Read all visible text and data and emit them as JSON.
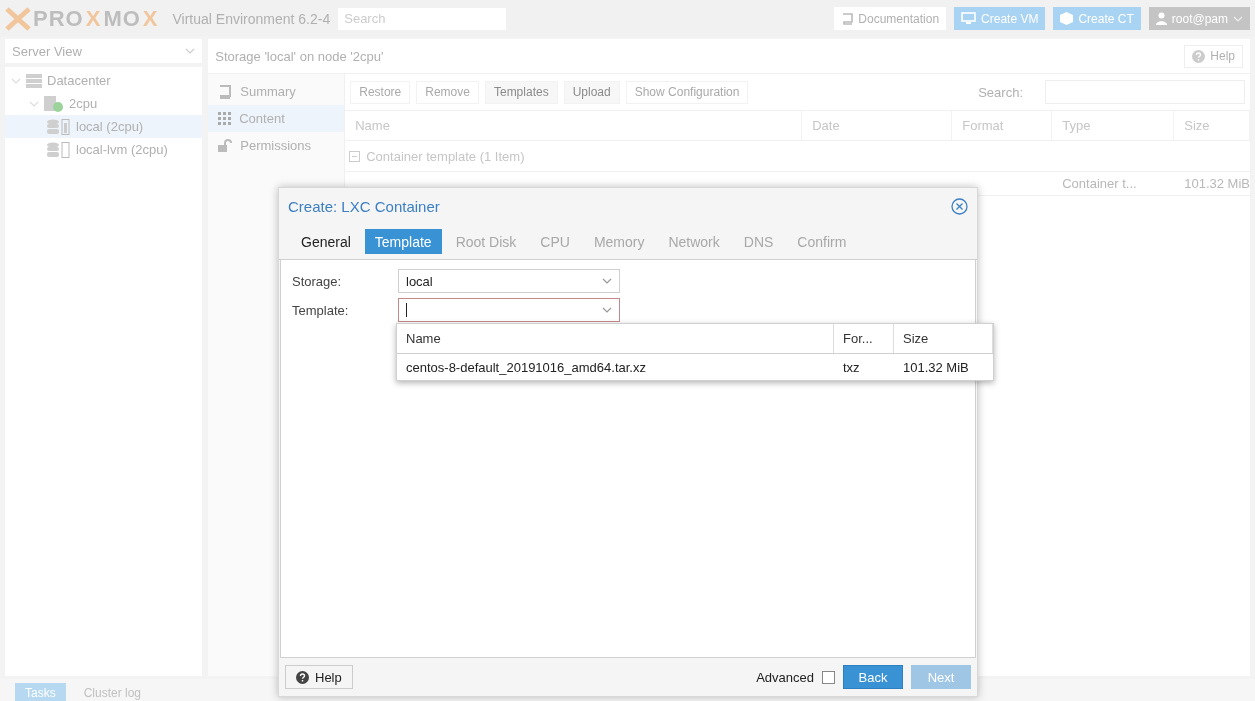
{
  "header": {
    "logo_parts": [
      {
        "text": "PRO",
        "accent": false
      },
      {
        "text": "X",
        "accent": true
      },
      {
        "text": "MO",
        "accent": false
      },
      {
        "text": "X",
        "accent": true
      }
    ],
    "product": "Virtual Environment 6.2-4",
    "search": {
      "placeholder": "Search"
    },
    "buttons": [
      {
        "kind": "doc",
        "label": "Documentation"
      },
      {
        "kind": "vm",
        "label": "Create VM"
      },
      {
        "kind": "ct",
        "label": "Create CT"
      },
      {
        "kind": "user",
        "label": "root@pam"
      }
    ]
  },
  "sidebar": {
    "view": "Server View",
    "tree": [
      {
        "label": "Datacenter",
        "kind": "datacenter",
        "selected": false,
        "children": [
          {
            "label": "2cpu",
            "kind": "node",
            "selected": false,
            "children": [
              {
                "label": "local (2cpu)",
                "kind": "storage",
                "selected": true
              },
              {
                "label": "local-lvm (2cpu)",
                "kind": "storage",
                "selected": false
              }
            ]
          }
        ]
      }
    ]
  },
  "content": {
    "title": "Storage 'local' on node '2cpu'",
    "help": "Help",
    "nav": [
      {
        "label": "Summary",
        "kind": "book",
        "selected": false
      },
      {
        "label": "Content",
        "kind": "grid",
        "selected": true
      },
      {
        "label": "Permissions",
        "kind": "lock",
        "selected": false
      }
    ],
    "toolbar": [
      {
        "label": "Restore",
        "disabled": true
      },
      {
        "label": "Remove",
        "disabled": true
      },
      {
        "label": "Templates",
        "disabled": false
      },
      {
        "label": "Upload",
        "disabled": false
      },
      {
        "label": "Show Configuration",
        "disabled": true
      }
    ],
    "search_label": "Search:",
    "columns": [
      "Name",
      "Date",
      "Format",
      "Type",
      "Size"
    ],
    "group": "Container template (1 Item)",
    "rows": [
      {
        "type": "Container t...",
        "size": "101.32 MiB"
      }
    ]
  },
  "dialog": {
    "title": "Create: LXC Container",
    "tabs": [
      {
        "label": "General",
        "selected": false,
        "disabled": false
      },
      {
        "label": "Template",
        "selected": true,
        "disabled": false
      },
      {
        "label": "Root Disk",
        "selected": false,
        "disabled": true
      },
      {
        "label": "CPU",
        "selected": false,
        "disabled": true
      },
      {
        "label": "Memory",
        "selected": false,
        "disabled": true
      },
      {
        "label": "Network",
        "selected": false,
        "disabled": true
      },
      {
        "label": "DNS",
        "selected": false,
        "disabled": true
      },
      {
        "label": "Confirm",
        "selected": false,
        "disabled": true
      }
    ],
    "fields": [
      {
        "label": "Storage:",
        "value": "local",
        "invalid": false
      },
      {
        "label": "Template:",
        "invalid": true
      }
    ],
    "picker": {
      "columns": [
        "Name",
        "For...",
        "Size"
      ],
      "rows": [
        [
          "centos-8-default_20191016_amd64.tar.xz",
          "txz",
          "101.32 MiB"
        ]
      ]
    },
    "help": "Help",
    "advanced": {
      "label": "Advanced",
      "checked": false
    },
    "buttons": [
      {
        "label": "Back",
        "disabled": false
      },
      {
        "label": "Next",
        "disabled": true
      }
    ]
  },
  "bottom_tabs": [
    {
      "label": "Tasks",
      "selected": true
    },
    {
      "label": "Cluster log",
      "selected": false
    }
  ]
}
